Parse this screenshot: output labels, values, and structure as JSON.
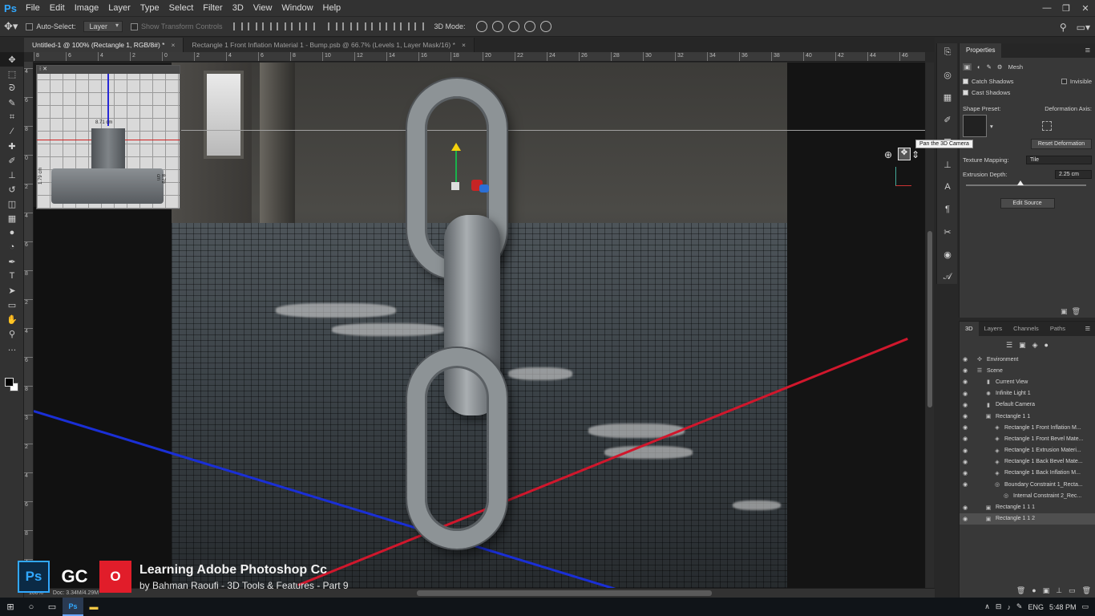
{
  "app": {
    "logo": "Ps",
    "menu": [
      "File",
      "Edit",
      "Image",
      "Layer",
      "Type",
      "Select",
      "Filter",
      "3D",
      "View",
      "Window",
      "Help"
    ],
    "window_controls": [
      "minimize-icon",
      "restore-icon",
      "close-icon"
    ]
  },
  "options_bar": {
    "auto_select_label": "Auto-Select:",
    "auto_select_value": "Layer",
    "show_transform_label": "Show Transform Controls",
    "mode_label": "3D Mode:"
  },
  "tabs": [
    {
      "label": "Untitled-1 @ 100% (Rectangle 1, RGB/8#) *",
      "active": true
    },
    {
      "label": "Rectangle 1 Front Inflation Material 1 - Bump.psb @ 66.7% (Levels 1, Layer Mask/16) *",
      "active": false
    }
  ],
  "tools": [
    "move-icon",
    "marquee-icon",
    "lasso-icon",
    "quick-select-icon",
    "crop-icon",
    "eyedropper-icon",
    "healing-icon",
    "brush-icon",
    "clone-stamp-icon",
    "history-brush-icon",
    "eraser-icon",
    "gradient-icon",
    "blur-icon",
    "dodge-icon",
    "pen-icon",
    "type-icon",
    "path-select-icon",
    "rectangle-icon",
    "hand-icon",
    "zoom-icon",
    "more-icon"
  ],
  "rulers": {
    "top": [
      "8",
      "6",
      "4",
      "2",
      "0",
      "2",
      "4",
      "6",
      "8",
      "10",
      "12",
      "14",
      "16",
      "18",
      "20",
      "22",
      "24",
      "26",
      "28",
      "30",
      "32",
      "34",
      "36",
      "38",
      "40",
      "42",
      "44",
      "46"
    ],
    "left": [
      "4",
      "6",
      "8",
      "0",
      "2",
      "4",
      "6",
      "8",
      "2",
      "4",
      "6",
      "8",
      "3",
      "2",
      "4",
      "6",
      "8",
      "4"
    ]
  },
  "secondary_view": {
    "dim_top": "8.71 cm",
    "dim_left": "1.79 cm",
    "dim_right": "8.79 cm"
  },
  "tooltip": "Pan the 3D Camera",
  "properties": {
    "title": "Properties",
    "section": "Mesh",
    "catch_shadows": "Catch Shadows",
    "invisible": "Invisible",
    "cast_shadows": "Cast Shadows",
    "shape_preset_label": "Shape Preset:",
    "deformation_axis_label": "Deformation Axis:",
    "reset_deformation": "Reset Deformation",
    "texture_mapping_label": "Texture Mapping:",
    "texture_mapping_value": "Tile",
    "extrusion_depth_label": "Extrusion Depth:",
    "extrusion_depth_value": "2.25 cm",
    "extrusion_depth_slider": 0.45,
    "edit_source": "Edit Source"
  },
  "panel3d": {
    "tabs": [
      "3D",
      "Layers",
      "Channels",
      "Paths"
    ],
    "items": [
      {
        "label": "Environment",
        "indent": 0,
        "eye": true,
        "icon": "environment-icon"
      },
      {
        "label": "Scene",
        "indent": 0,
        "eye": true,
        "icon": "scene-icon"
      },
      {
        "label": "Current View",
        "indent": 1,
        "eye": true,
        "icon": "camera-icon"
      },
      {
        "label": "Infinite Light 1",
        "indent": 1,
        "eye": true,
        "icon": "light-icon"
      },
      {
        "label": "Default Camera",
        "indent": 1,
        "eye": true,
        "icon": "camera-icon"
      },
      {
        "label": "Rectangle 1 1",
        "indent": 1,
        "eye": true,
        "icon": "mesh-icon"
      },
      {
        "label": "Rectangle 1 Front Inflation M...",
        "indent": 2,
        "eye": true,
        "icon": "material-icon"
      },
      {
        "label": "Rectangle 1 Front Bevel Mate...",
        "indent": 2,
        "eye": true,
        "icon": "material-icon"
      },
      {
        "label": "Rectangle 1 Extrusion Materi...",
        "indent": 2,
        "eye": true,
        "icon": "material-icon"
      },
      {
        "label": "Rectangle 1 Back Bevel Mate...",
        "indent": 2,
        "eye": true,
        "icon": "material-icon"
      },
      {
        "label": "Rectangle 1 Back Inflation M...",
        "indent": 2,
        "eye": true,
        "icon": "material-icon"
      },
      {
        "label": "Boundary Constraint 1_Recta...",
        "indent": 2,
        "eye": true,
        "icon": "constraint-icon"
      },
      {
        "label": "Internal Constraint 2_Rec...",
        "indent": 3,
        "eye": false,
        "icon": "constraint-icon"
      },
      {
        "label": "Rectangle 1 1 1",
        "indent": 1,
        "eye": true,
        "icon": "mesh-icon"
      },
      {
        "label": "Rectangle 1 1 2",
        "indent": 1,
        "eye": true,
        "icon": "mesh-icon",
        "selected": true
      }
    ]
  },
  "status": {
    "zoom": "100%",
    "doc": "Doc: 3.34M/4.29M"
  },
  "watermark": {
    "title": "Learning Adobe Photoshop Cc",
    "subtitle": "by Bahman Raoufi - 3D Tools & Features - Part 9",
    "logo_ps": "Ps",
    "logo_gc": "GC",
    "logo_red": "O"
  },
  "taskbar": {
    "lang": "ENG",
    "time": "5:48 PM"
  },
  "colors": {
    "accent": "#31a8ff",
    "axis_red": "#d0172c",
    "axis_blue": "#1a2fd6"
  }
}
